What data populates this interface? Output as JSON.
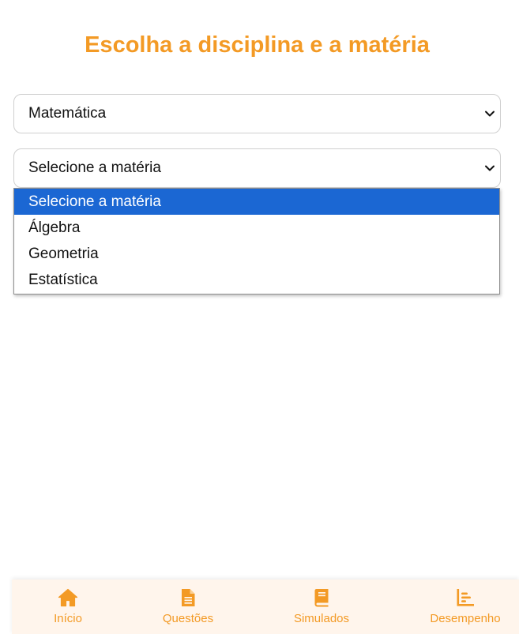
{
  "header": {
    "title": "Escolha a disciplina e a matéria"
  },
  "disciplina_select": {
    "selected": "Matemática"
  },
  "materia_select": {
    "selected": "Selecione a matéria",
    "options": [
      "Selecione a matéria",
      "Álgebra",
      "Geometria",
      "Estatística"
    ],
    "highlighted_index": 0
  },
  "bottom_nav": {
    "items": [
      {
        "label": "Início",
        "icon": "home-icon"
      },
      {
        "label": "Questões",
        "icon": "document-icon"
      },
      {
        "label": "Simulados",
        "icon": "book-icon"
      },
      {
        "label": "Desempenho",
        "icon": "chart-icon"
      }
    ]
  },
  "colors": {
    "accent": "#f39a25",
    "highlight": "#1b67d3",
    "nav_background": "#fff5ec"
  }
}
